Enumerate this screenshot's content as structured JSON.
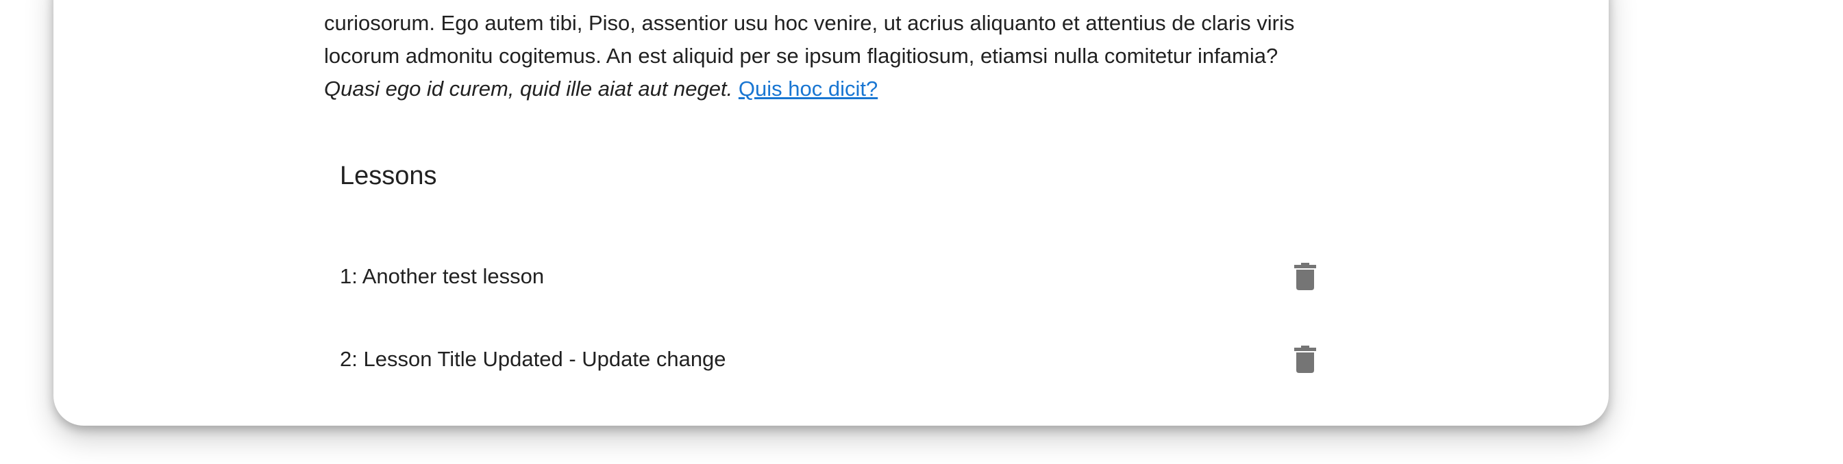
{
  "description": {
    "line1_partial": "curiosorum. Ego autem tibi, Piso, assentior usu hoc venire, ut acrius aliquanto et attentius de claris viris",
    "line2": "locorum admonitu cogitemus. An est aliquid per se ipsum flagitiosum, etiamsi nulla comitetur infamia?",
    "line3_italic": "Quasi ego id curem, quid ille aiat aut neget.",
    "line3_link": "Quis hoc dicit?"
  },
  "lessons": {
    "title": "Lessons",
    "items": [
      {
        "label": "1: Another test lesson",
        "action_icon": "trash-icon"
      },
      {
        "label": "2: Lesson Title Updated - Update change",
        "action_icon": "trash-icon"
      }
    ]
  },
  "colors": {
    "link": "#1976d2",
    "icon": "#757575",
    "text": "#212121"
  }
}
